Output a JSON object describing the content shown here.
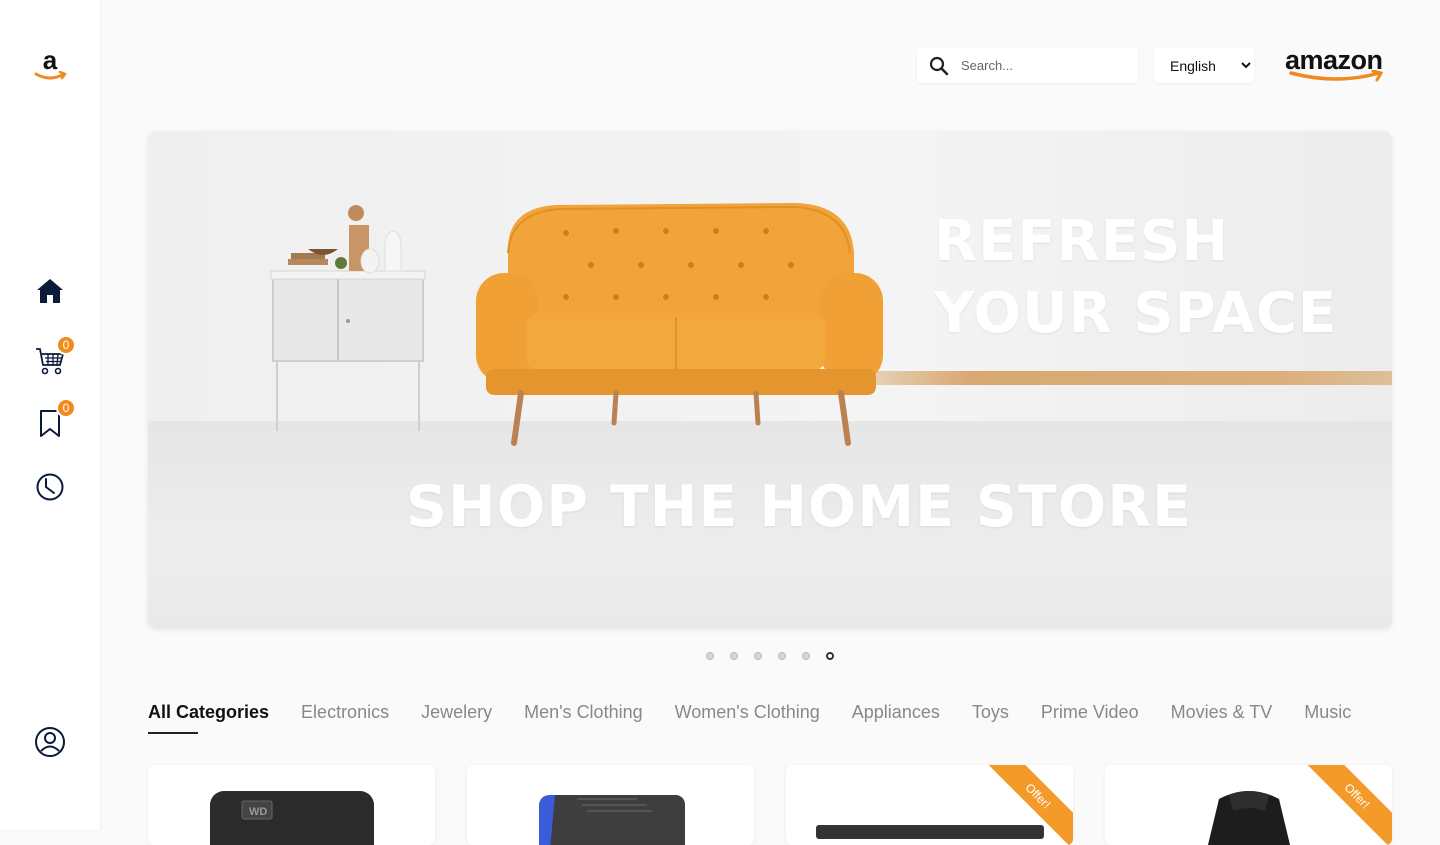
{
  "header": {
    "search_placeholder": "Search...",
    "language_selected": "English",
    "brand_name": "amazon"
  },
  "sidebar": {
    "logo_letter": "a",
    "items": [
      {
        "icon": "home-icon"
      },
      {
        "icon": "cart-icon",
        "badge": "0"
      },
      {
        "icon": "bookmark-icon",
        "badge": "0"
      },
      {
        "icon": "history-icon"
      }
    ],
    "profile_icon": "user-icon"
  },
  "banner": {
    "headline_line1": "REFRESH",
    "headline_line2": "YOUR SPACE",
    "subheadline": "SHOP THE HOME STORE",
    "slide_count": 6,
    "active_slide": 6
  },
  "categories": {
    "tabs": [
      "All Categories",
      "Electronics",
      "Jewelery",
      "Men's Clothing",
      "Women's Clothing",
      "Appliances",
      "Toys",
      "Prime Video",
      "Movies & TV",
      "Music"
    ],
    "active_index": 0
  },
  "products": [
    {
      "offer": ""
    },
    {
      "offer": ""
    },
    {
      "offer": "Offer!"
    },
    {
      "offer": "Offer!"
    }
  ],
  "colors": {
    "accent": "#f08a1c",
    "sofa": "#f2a33a"
  }
}
